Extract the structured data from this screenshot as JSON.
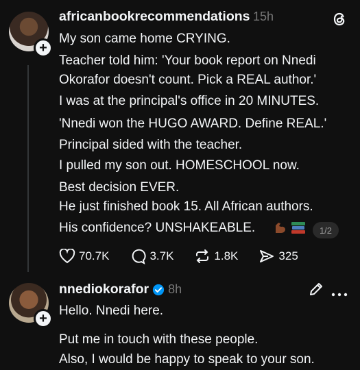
{
  "post": {
    "username": "africanbookrecommendations",
    "time": "15h",
    "lines": [
      "My son came home CRYING.",
      "Teacher told him: 'Your book report on Nnedi",
      "Okorafor doesn't count. Pick a REAL author.'",
      "I was at the principal's office in 20 MINUTES.",
      "'Nnedi won the HUGO AWARD. Define REAL.'",
      "Principal sided with the teacher.",
      "I pulled my son out. HOMESCHOOL now.",
      "Best decision EVER.",
      "He just finished book 15. All African authors.",
      "His confidence? UNSHAKEABLE."
    ],
    "emoji_icons": [
      "flexed-biceps-icon",
      "books-icon"
    ],
    "page_indicator": "1/2",
    "likes": "70.7K",
    "replies": "3.7K",
    "reposts": "1.8K",
    "shares": "325"
  },
  "reply": {
    "username": "nnediokorafor",
    "verified": true,
    "time": "8h",
    "lines": [
      "Hello. Nnedi here.",
      "",
      "Put me in touch with these people.",
      "Also, I would be happy to speak to your son."
    ]
  },
  "colors": {
    "background": "#101010",
    "text": "#f3f5f7",
    "muted": "#777777",
    "verified": "#0095f6"
  }
}
